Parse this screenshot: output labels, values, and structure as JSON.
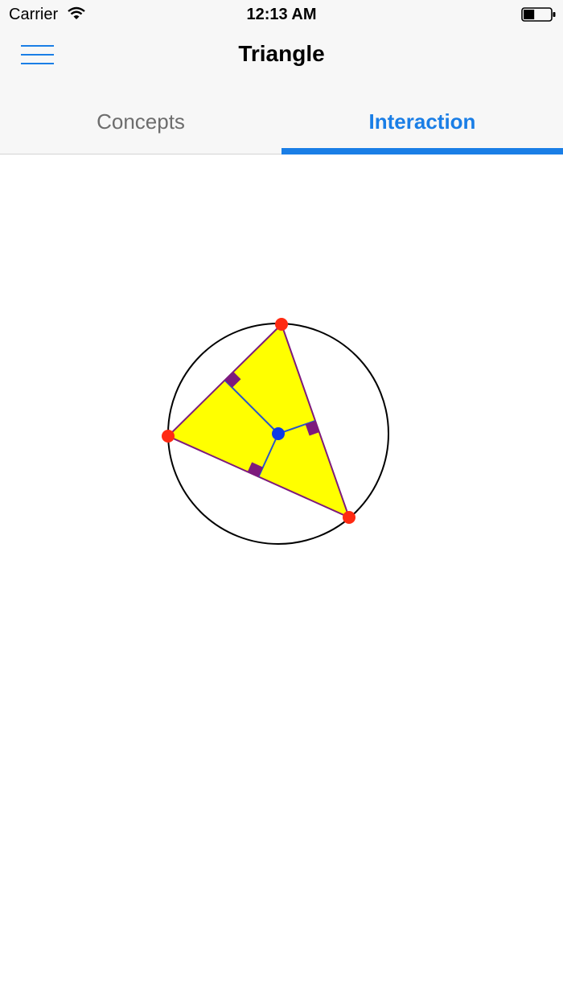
{
  "status_bar": {
    "carrier": "Carrier",
    "time": "12:13 AM",
    "wifi_icon": "wifi-icon",
    "battery_icon": "battery-icon",
    "battery_level": 0.4
  },
  "nav": {
    "title": "Triangle",
    "menu_icon": "hamburger-menu-icon",
    "accent_color": "#1a7ee6"
  },
  "tabs": [
    {
      "label": "Concepts",
      "selected": false
    },
    {
      "label": "Interaction",
      "selected": true
    }
  ],
  "diagram": {
    "fill_color": "#ffff00",
    "vertex_color": "#ff2a12",
    "center_color": "#0c3ae6",
    "right_angle_color": "#7d1a7d",
    "circle_color": "#000000"
  }
}
